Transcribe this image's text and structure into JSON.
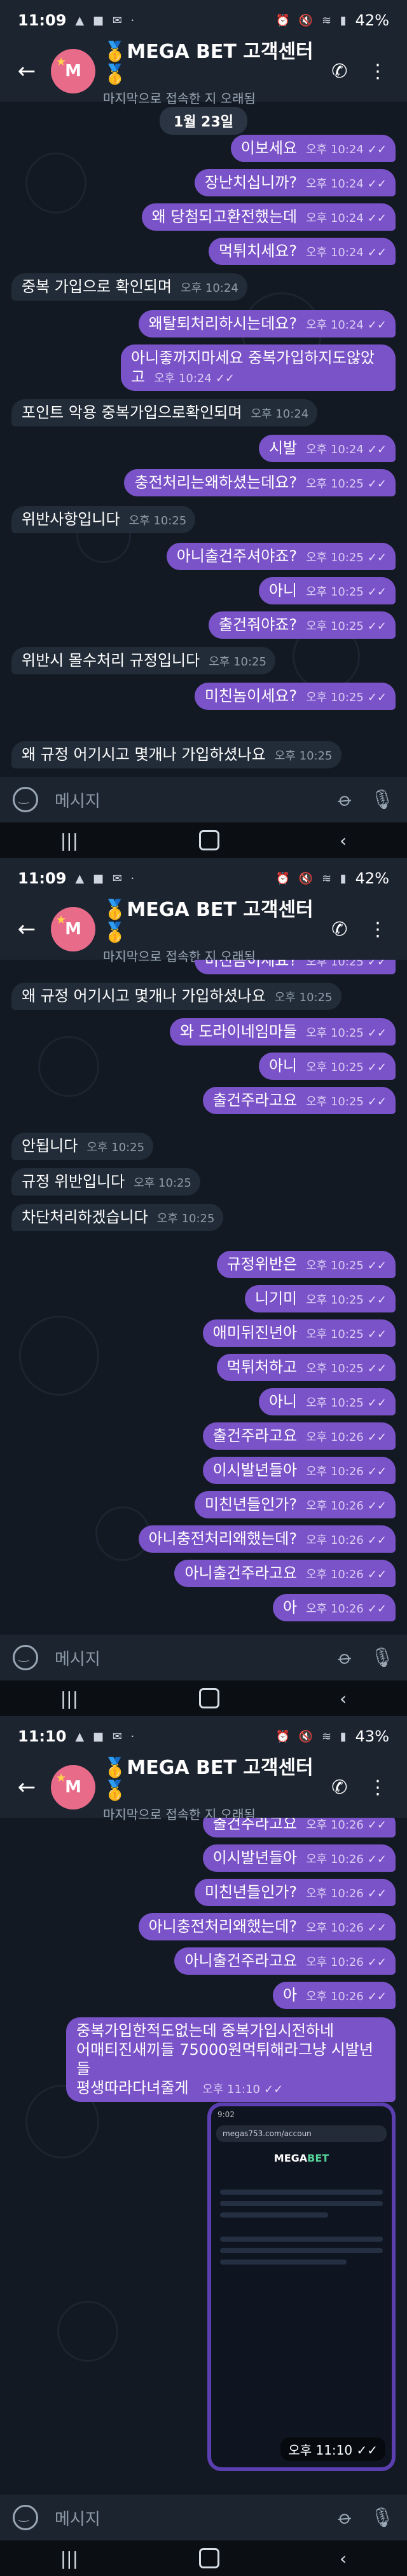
{
  "colors": {
    "outgoing": "#7b53c9",
    "incoming": "#222c38",
    "header": "#1c2430"
  },
  "screens": [
    {
      "status": {
        "time": "11:09",
        "icons": "▲ ■ ✉ ·",
        "signal": "⏰ 🔇 ≋ ▮",
        "battery": "42%"
      },
      "header": {
        "title": "🥇MEGA BET 고객센터🥇",
        "subtitle": "마지막으로 접속한 지 오래됨",
        "avatar": "M"
      },
      "date": "1월 23일",
      "input_placeholder": "메시지",
      "messages": [
        {
          "dir": "out",
          "text": "이보세요",
          "time": "오후 10:24"
        },
        {
          "dir": "out",
          "text": "장난치십니까?",
          "time": "오후 10:24"
        },
        {
          "dir": "out",
          "text": "왜 당첨되고환전했는데",
          "time": "오후 10:24"
        },
        {
          "dir": "out",
          "text": "먹튀치세요?",
          "time": "오후 10:24"
        },
        {
          "dir": "in",
          "text": "중복 가입으로 확인되며",
          "time": "오후 10:24"
        },
        {
          "dir": "out",
          "text": "왜탈퇴처리하시는데요?",
          "time": "오후 10:24"
        },
        {
          "dir": "out",
          "text": "아니좋까지마세요 중복가입하지도않았고",
          "time": "오후 10:24"
        },
        {
          "dir": "in",
          "text": "포인트 악용 중복가입으로확인되며",
          "time": "오후 10:24"
        },
        {
          "dir": "out",
          "text": "시발",
          "time": "오후 10:24"
        },
        {
          "dir": "out",
          "text": "충전처리는왜하셨는데요?",
          "time": "오후 10:25"
        },
        {
          "dir": "in",
          "text": "위반사항입니다",
          "time": "오후 10:25"
        },
        {
          "dir": "out",
          "text": "아니출건주셔야죠?",
          "time": "오후 10:25"
        },
        {
          "dir": "out",
          "text": "아니",
          "time": "오후 10:25"
        },
        {
          "dir": "out",
          "text": "출건줘야죠?",
          "time": "오후 10:25"
        },
        {
          "dir": "in",
          "text": "위반시 몰수처리 규정입니다",
          "time": "오후 10:25"
        },
        {
          "dir": "out",
          "text": "미친놈이세요?",
          "time": "오후 10:25"
        },
        {
          "dir": "in",
          "text": "왜 규정 어기시고 몇개나 가입하셨나요",
          "time": "오후 10:25"
        }
      ]
    },
    {
      "status": {
        "time": "11:09",
        "icons": "▲ ■ ✉ ·",
        "signal": "⏰ 🔇 ≋ ▮",
        "battery": "42%"
      },
      "header": {
        "title": "🥇MEGA BET 고객센터🥇",
        "subtitle": "마지막으로 접속한 지 오래됨",
        "avatar": "M"
      },
      "input_placeholder": "메시지",
      "messages": [
        {
          "dir": "out",
          "text": "미친놈이세요?",
          "time": "오후 10:25"
        },
        {
          "dir": "in",
          "text": "왜 규정 어기시고 몇개나 가입하셨나요",
          "time": "오후 10:25"
        },
        {
          "dir": "out",
          "text": "와 도라이네임마들",
          "time": "오후 10:25"
        },
        {
          "dir": "out",
          "text": "아니",
          "time": "오후 10:25"
        },
        {
          "dir": "out",
          "text": "출건주라고요",
          "time": "오후 10:25"
        },
        {
          "dir": "in",
          "text": "안됩니다",
          "time": "오후 10:25"
        },
        {
          "dir": "in",
          "text": "규정 위반입니다",
          "time": "오후 10:25"
        },
        {
          "dir": "in",
          "text": "차단처리하겠습니다",
          "time": "오후 10:25"
        },
        {
          "dir": "out",
          "text": "규정위반은",
          "time": "오후 10:25"
        },
        {
          "dir": "out",
          "text": "니기미",
          "time": "오후 10:25"
        },
        {
          "dir": "out",
          "text": "애미뒤진년아",
          "time": "오후 10:25"
        },
        {
          "dir": "out",
          "text": "먹튀처하고",
          "time": "오후 10:25"
        },
        {
          "dir": "out",
          "text": "아니",
          "time": "오후 10:25"
        },
        {
          "dir": "out",
          "text": "출건주라고요",
          "time": "오후 10:26"
        },
        {
          "dir": "out",
          "text": "이시발년들아",
          "time": "오후 10:26"
        },
        {
          "dir": "out",
          "text": "미친년들인가?",
          "time": "오후 10:26"
        },
        {
          "dir": "out",
          "text": "아니충전처리왜했는데?",
          "time": "오후 10:26"
        },
        {
          "dir": "out",
          "text": "아니출건주라고요",
          "time": "오후 10:26"
        },
        {
          "dir": "out",
          "text": "아",
          "time": "오후 10:26"
        }
      ]
    },
    {
      "status": {
        "time": "11:10",
        "icons": "▲ ■ ✉ ·",
        "signal": "⏰ 🔇 ≋ ▮",
        "battery": "43%"
      },
      "header": {
        "title": "🥇MEGA BET 고객센터🥇",
        "subtitle": "마지막으로 접속한 지 오래됨",
        "avatar": "M"
      },
      "input_placeholder": "메시지",
      "messages": [
        {
          "dir": "out",
          "text": "출건주라고요",
          "time": "오후 10:26"
        },
        {
          "dir": "out",
          "text": "이시발년들아",
          "time": "오후 10:26"
        },
        {
          "dir": "out",
          "text": "미친년들인가?",
          "time": "오후 10:26"
        },
        {
          "dir": "out",
          "text": "아니충전처리왜했는데?",
          "time": "오후 10:26"
        },
        {
          "dir": "out",
          "text": "아니출건주라고요",
          "time": "오후 10:26"
        },
        {
          "dir": "out",
          "text": "아",
          "time": "오후 10:26"
        },
        {
          "dir": "out",
          "text": "중복가입한적도없는데 중복가입시전하네\n어매티진새끼들 75000원먹튀해라그냥 시발년들\n평생따라다녀줄게",
          "time": "오후 11:10"
        }
      ],
      "image_message": {
        "time": "오후 11:10",
        "status_time": "9:02",
        "url": "megas753.com/accoun",
        "brand": "MEGA",
        "brand_accent": "BET"
      }
    }
  ]
}
